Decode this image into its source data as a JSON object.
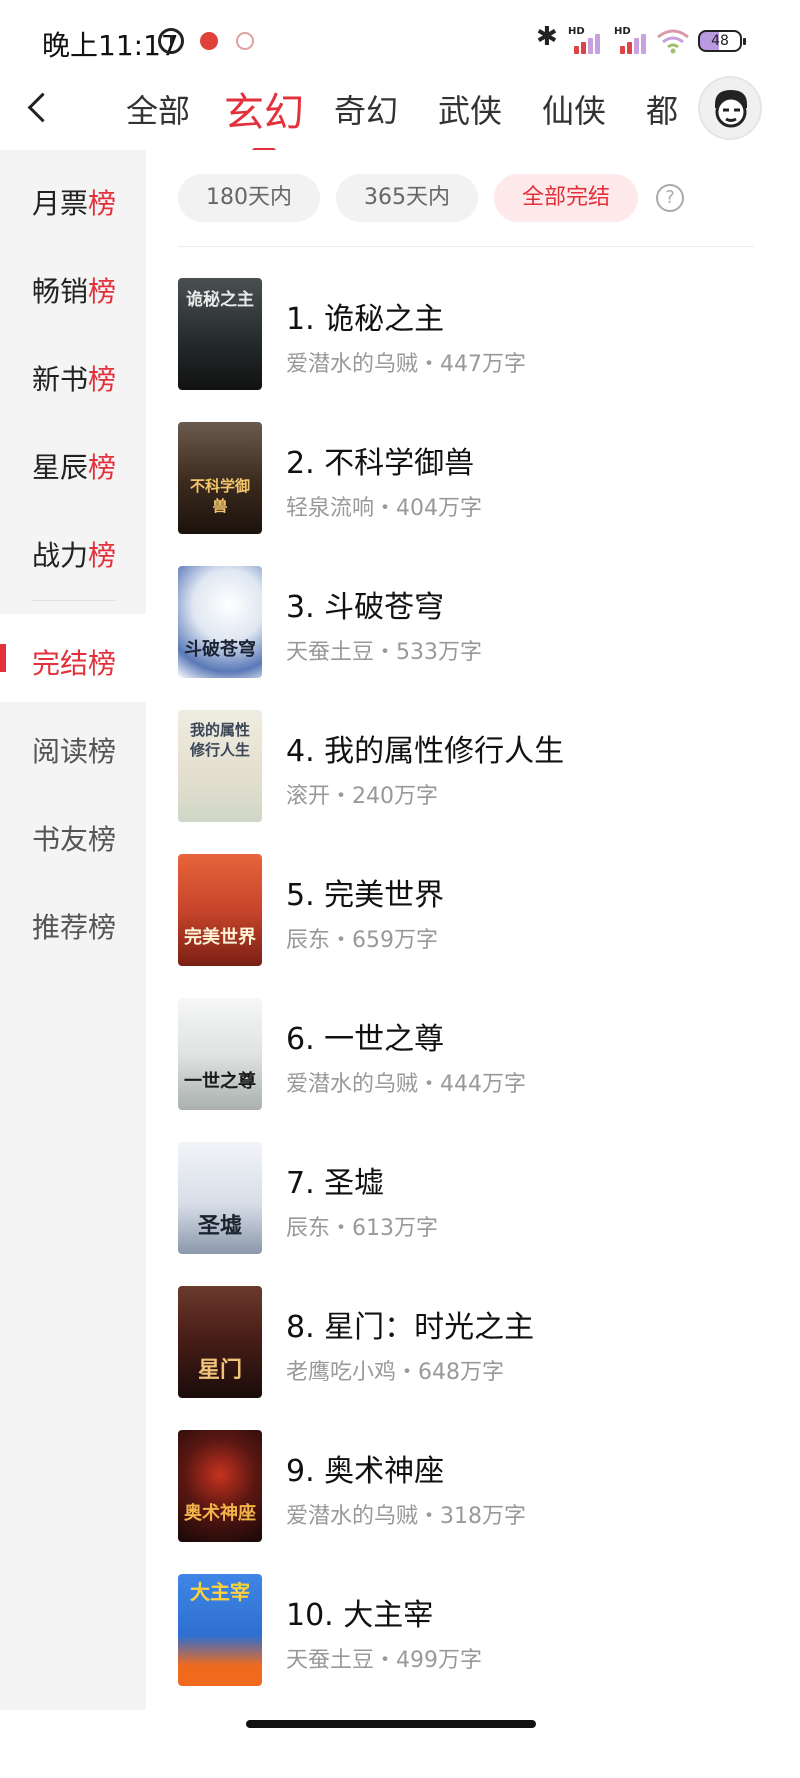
{
  "status_bar": {
    "time": "晚上11:17",
    "battery": "48"
  },
  "nav": {
    "tabs": [
      "全部",
      "玄幻",
      "奇幻",
      "武侠",
      "仙侠",
      "都"
    ],
    "active_tab": "玄幻"
  },
  "sidebar": {
    "items": [
      {
        "accent_lead": "月票",
        "accent_tail": "榜"
      },
      {
        "accent_lead": "畅销",
        "accent_tail": "榜"
      },
      {
        "accent_lead": "新书",
        "accent_tail": "榜"
      },
      {
        "accent_lead": "星辰",
        "accent_tail": "榜"
      },
      {
        "accent_lead": "战力",
        "accent_tail": "榜"
      }
    ],
    "active": "完结榜",
    "others": [
      "阅读榜",
      "书友榜",
      "推荐榜"
    ]
  },
  "filters": {
    "options": [
      "180天内",
      "365天内",
      "全部完结"
    ],
    "selected": "全部完结",
    "help": "?"
  },
  "books": [
    {
      "title": "1. 诡秘之主",
      "meta": "爱潜水的乌贼・447万字",
      "cover_text": "诡秘之主",
      "cover_color": "#2e3334"
    },
    {
      "title": "2. 不科学御兽",
      "meta": "轻泉流响・404万字",
      "cover_text": "不科学御兽",
      "cover_color": "#3a2a1e"
    },
    {
      "title": "3. 斗破苍穹",
      "meta": "天蚕土豆・533万字",
      "cover_text": "斗破苍穹",
      "cover_color": "#e9eef5"
    },
    {
      "title": "4. 我的属性修行人生",
      "meta": "滚开・240万字",
      "cover_text": "我的属性修行人生",
      "cover_color": "#e8e4d6"
    },
    {
      "title": "5. 完美世界",
      "meta": "辰东・659万字",
      "cover_text": "完美世界",
      "cover_color": "#c8452c"
    },
    {
      "title": "6. 一世之尊",
      "meta": "爱潜水的乌贼・444万字",
      "cover_text": "一世之尊",
      "cover_color": "#eef0f0"
    },
    {
      "title": "7. 圣墟",
      "meta": "辰东・613万字",
      "cover_text": "圣墟",
      "cover_color": "#e6ebf1"
    },
    {
      "title": "8. 星门：时光之主",
      "meta": "老鹰吃小鸡・648万字",
      "cover_text": "星门",
      "cover_color": "#4a1e18"
    },
    {
      "title": "9. 奥术神座",
      "meta": "爱潜水的乌贼・318万字",
      "cover_text": "奥术神座",
      "cover_color": "#2a1412"
    },
    {
      "title": "10. 大主宰",
      "meta": "天蚕土豆・499万字",
      "cover_text": "大主宰",
      "cover_color": "#2f6fcf"
    }
  ],
  "colors": {
    "accent": "#e2313b",
    "sidebar_bg": "#f4f4f4"
  }
}
